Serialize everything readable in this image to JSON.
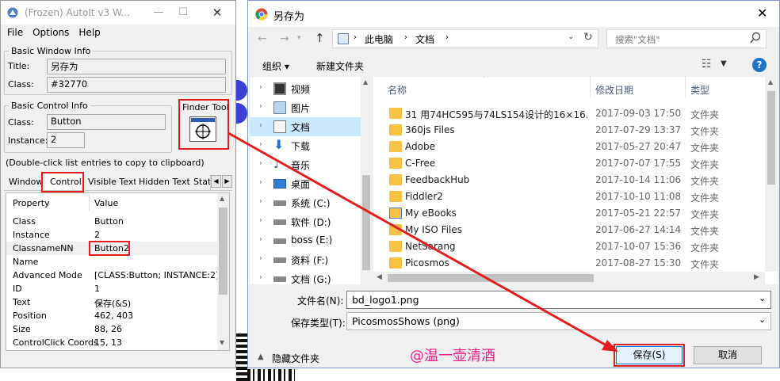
{
  "autoit": {
    "title": "(Frozen) AutoIt v3 W...",
    "menu": [
      "File",
      "Options",
      "Help"
    ],
    "basic_window": {
      "group_title": "Basic Window Info",
      "title_label": "Title:",
      "title_value": "另存为",
      "class_label": "Class:",
      "class_value": "#32770"
    },
    "basic_control": {
      "group_title": "Basic Control Info",
      "class_label": "Class:",
      "class_value": "Button",
      "instance_label": "Instance:",
      "instance_value": "2"
    },
    "finder_tool": "Finder Tool",
    "hint": "(Double-click list entries to copy to clipboard)",
    "tabs": [
      "Window",
      "Control",
      "Visible Text",
      "Hidden Text",
      "Stat"
    ],
    "active_tab": "Control",
    "prop_headers": {
      "property": "Property",
      "value": "Value"
    },
    "properties": [
      {
        "k": "Class",
        "v": "Button"
      },
      {
        "k": "Instance",
        "v": "2"
      },
      {
        "k": "ClassnameNN",
        "v": "Button2"
      },
      {
        "k": "Name",
        "v": ""
      },
      {
        "k": "Advanced Mode",
        "v": "[CLASS:Button; INSTANCE:2]"
      },
      {
        "k": "ID",
        "v": "1"
      },
      {
        "k": "Text",
        "v": "保存(&S)"
      },
      {
        "k": "Position",
        "v": "462, 403"
      },
      {
        "k": "Size",
        "v": "88, 26"
      },
      {
        "k": "ControlClick Coords",
        "v": "15, 13"
      }
    ]
  },
  "saveas": {
    "title": "另存为",
    "breadcrumb": [
      "此电脑",
      "文档"
    ],
    "search_placeholder": "搜索\"文档\"",
    "organize": "组织 ▾",
    "new_folder": "新建文件夹",
    "tree": [
      {
        "label": "视频",
        "icon": "video-icon"
      },
      {
        "label": "图片",
        "icon": "picture-icon"
      },
      {
        "label": "文档",
        "icon": "document-icon"
      },
      {
        "label": "下载",
        "icon": "download-icon"
      },
      {
        "label": "音乐",
        "icon": "music-icon"
      },
      {
        "label": "桌面",
        "icon": "desktop-icon"
      },
      {
        "label": "系统 (C:)",
        "icon": "drive-icon"
      },
      {
        "label": "软件 (D:)",
        "icon": "drive-icon"
      },
      {
        "label": "boss (E:)",
        "icon": "drive-icon"
      },
      {
        "label": "资料 (F:)",
        "icon": "drive-icon"
      },
      {
        "label": "文档 (G:)",
        "icon": "drive-icon"
      }
    ],
    "columns": {
      "name": "名称",
      "date": "修改日期",
      "type": "类型"
    },
    "files": [
      {
        "name": "31 用74HC595与74LS154设计的16×16...",
        "date": "2017-09-03 17:50",
        "type": "文件夹"
      },
      {
        "name": "360js Files",
        "date": "2017-07-29 13:37",
        "type": "文件夹"
      },
      {
        "name": "Adobe",
        "date": "2017-05-27 20:47",
        "type": "文件夹"
      },
      {
        "name": "C-Free",
        "date": "2017-07-07 17:55",
        "type": "文件夹"
      },
      {
        "name": "FeedbackHub",
        "date": "2017-10-14 11:06",
        "type": "文件夹"
      },
      {
        "name": "Fiddler2",
        "date": "2017-10-10 11:08",
        "type": "文件夹"
      },
      {
        "name": "My eBooks",
        "date": "2017-05-21 22:57",
        "type": "文件夹"
      },
      {
        "name": "My ISO Files",
        "date": "2017-06-27 14:14",
        "type": "文件夹"
      },
      {
        "name": "NetSarang",
        "date": "2017-10-07 15:36",
        "type": "文件夹"
      },
      {
        "name": "Picosmos",
        "date": "2017-08-27 15:30",
        "type": "文件夹"
      }
    ],
    "filename_label": "文件名(N):",
    "filename_value": "bd_logo1.png",
    "filetype_label": "保存类型(T):",
    "filetype_value": "PicosmosShows (png)",
    "hide_folders": "隐藏文件夹",
    "watermark": "@温一壶清酒",
    "save": "保存(S)",
    "cancel": "取消"
  },
  "colors": {
    "highlight_red": "#e41e1e",
    "selected_tree": "#cce8ff",
    "folder_yellow": "#f6c343",
    "watermark": "#f01b8a"
  }
}
